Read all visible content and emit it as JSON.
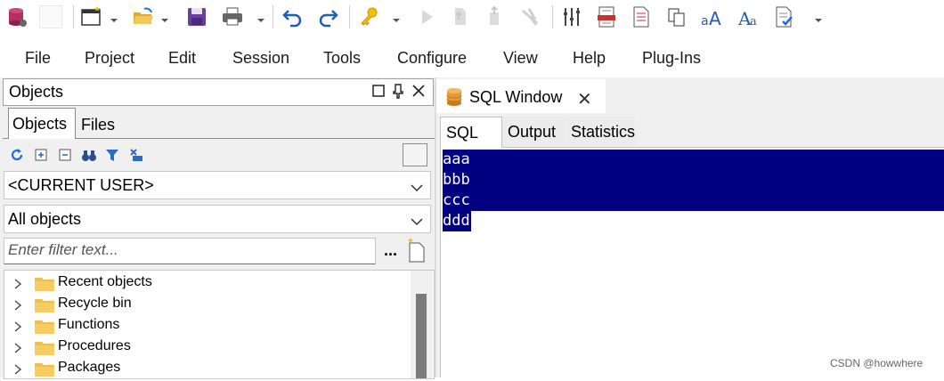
{
  "toolbar": {
    "icons": [
      "database-icon",
      "blank-icon",
      "new-window-icon",
      "open-folder-icon",
      "save-icon",
      "print-icon",
      "undo-icon",
      "redo-icon",
      "key-icon",
      "execute-icon",
      "commit-icon",
      "rollback-icon",
      "break-icon",
      "columns-icon",
      "report-icon",
      "document-icon",
      "copy-icon",
      "font-aa-icon",
      "font-aa-serif-icon",
      "spellcheck-icon",
      "overflow-icon"
    ]
  },
  "menu": {
    "items": [
      "File",
      "Project",
      "Edit",
      "Session",
      "Tools",
      "Configure",
      "View",
      "Help",
      "Plug-Ins"
    ]
  },
  "objects_panel": {
    "title": "Objects",
    "tabs": [
      "Objects",
      "Files"
    ],
    "user_combo": "<CURRENT USER>",
    "type_combo": "All objects",
    "filter_placeholder": "Enter filter text...",
    "dots": "...",
    "tree": [
      "Recent objects",
      "Recycle bin",
      "Functions",
      "Procedures",
      "Packages"
    ]
  },
  "sql_window": {
    "tab_title": "SQL Window",
    "close": "✕",
    "subtabs": [
      "SQL",
      "Output",
      "Statistics"
    ],
    "lines": [
      "aaa",
      "bbb",
      "ccc",
      "ddd"
    ]
  },
  "watermark": "CSDN @howwhere",
  "colors": {
    "selection": "#000080",
    "accent_blue": "#1e6fd9",
    "save_purple": "#6a3ea1",
    "folder_yellow": "#f2c04a"
  }
}
